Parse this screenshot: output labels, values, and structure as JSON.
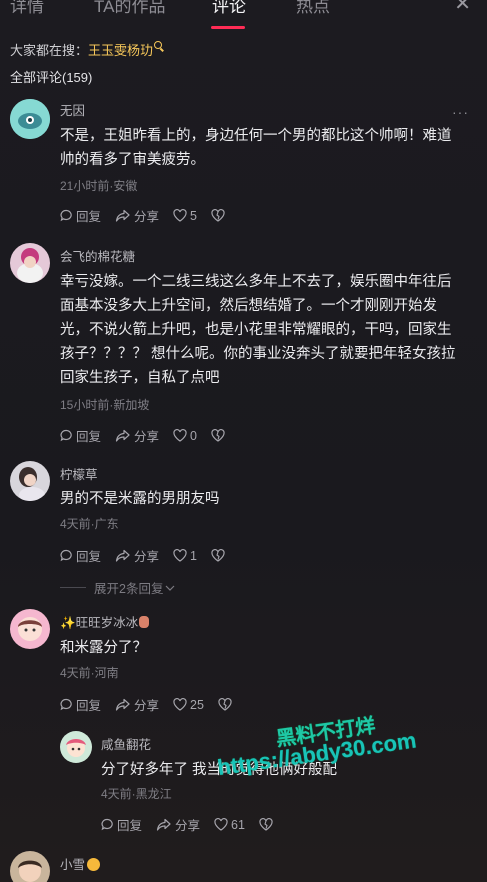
{
  "tabs": [
    "详情",
    "TA的作品",
    "评论",
    "热点"
  ],
  "search": {
    "prefix": "大家都在搜：",
    "keyword": "王玉雯杨玏"
  },
  "comments_count": "全部评论(159)",
  "actions": {
    "reply": "回复",
    "share": "分享"
  },
  "comments": [
    {
      "name": "无因",
      "text": "不是，王姐昨看上的，身边任何一个男的都比这个帅啊！难道帅的看多了审美疲劳。",
      "meta": "21小时前·安徽",
      "likes": "5"
    },
    {
      "name": "会飞的棉花糖",
      "text": "幸亏没嫁。一个二线三线这么多年上不去了，娱乐圈中年往后面基本没多大上升空间，然后想结婚了。一个才刚刚开始发光，不说火箭上升吧，也是小花里非常耀眼的，干吗，回家生孩子？？？？ 想什么呢。你的事业没奔头了就要把年轻女孩拉回家生孩子，自私了点吧",
      "meta": "15小时前·新加坡",
      "likes": "0"
    },
    {
      "name": "柠檬草",
      "text": "男的不是米露的男朋友吗",
      "meta": "4天前·广东",
      "likes": "1"
    },
    {
      "name": "旺旺岁冰冰",
      "text": "和米露分了？",
      "meta": "4天前·河南",
      "likes": "25"
    },
    {
      "name": "咸鱼翻花",
      "text": "分了好多年了  我当时觉得他俩好般配",
      "meta": "4天前·黑龙江",
      "likes": "61"
    },
    {
      "name": "小雪",
      "text": "",
      "meta": "",
      "likes": ""
    }
  ],
  "expand_replies": "展开2条回复",
  "watermark": {
    "line1": "黑料不打烊",
    "line2": "https://abdy30.com"
  },
  "colors": {
    "accent": "#fe2c55",
    "keyword": "#f7c85a",
    "background": "#1b1a1f"
  }
}
